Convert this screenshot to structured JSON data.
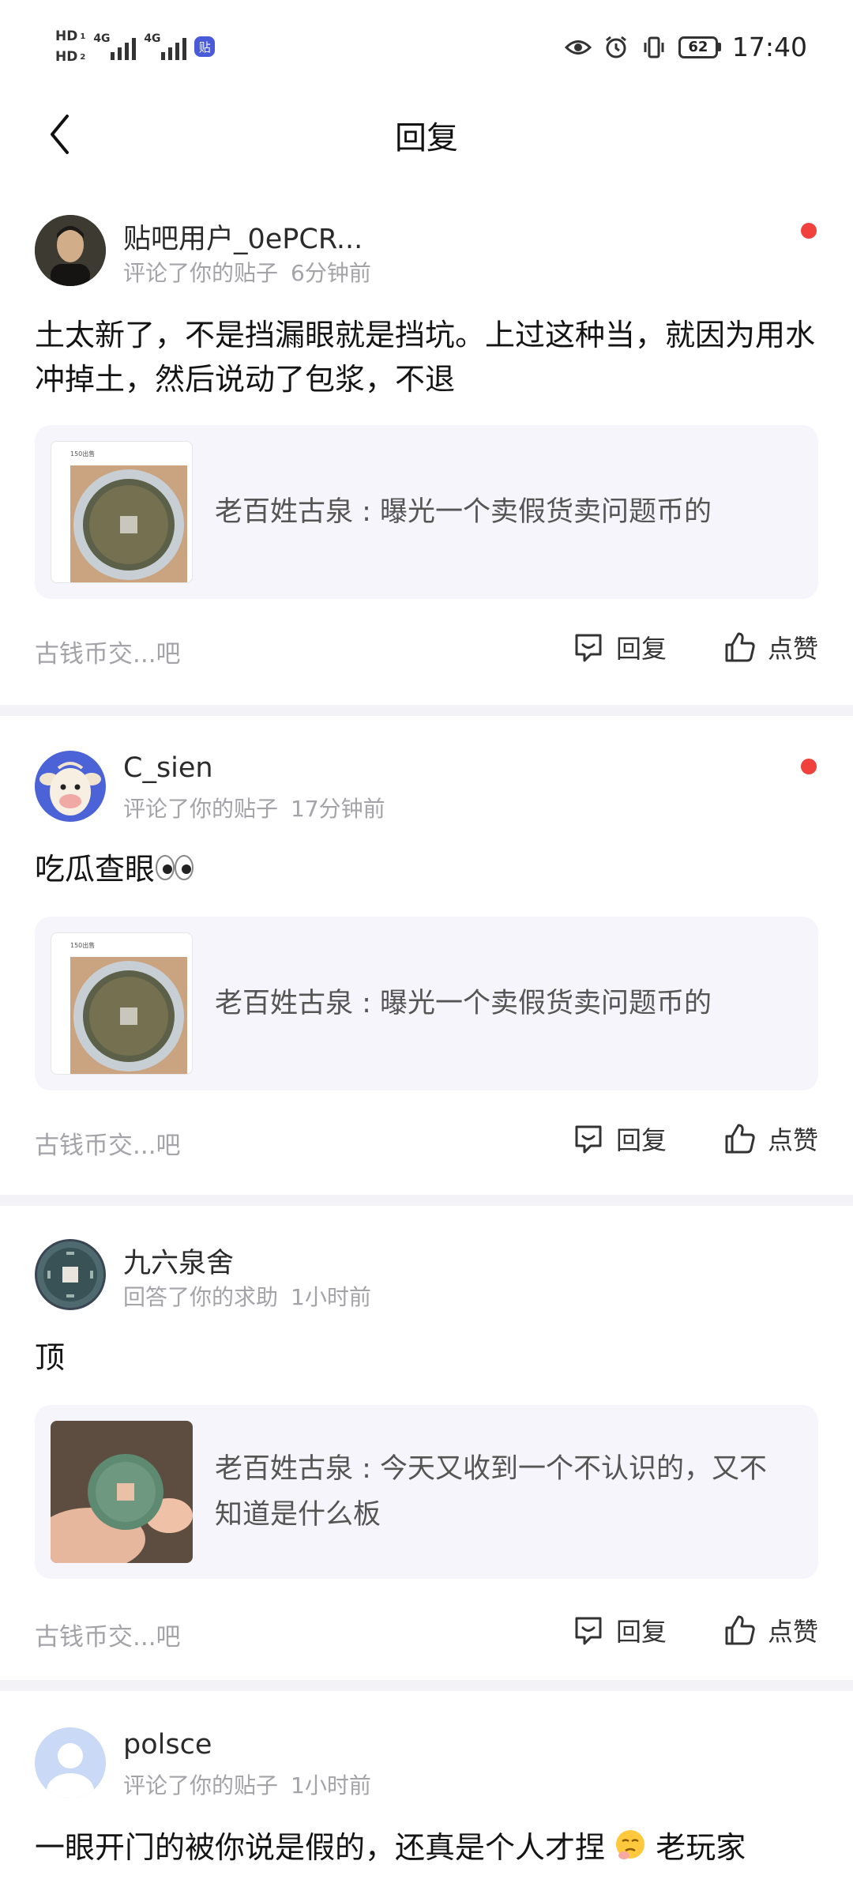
{
  "status_bar": {
    "hd1": "HD",
    "hd1_sub": "1",
    "hd2": "HD",
    "hd2_sub": "2",
    "net1": "4G",
    "net2": "4G",
    "app_badge": "贴",
    "battery": "62",
    "time": "17:40"
  },
  "nav": {
    "title": "回复",
    "back_icon": "back-arrow-icon"
  },
  "items": [
    {
      "username": "贴吧用户_0ePCR...",
      "action": "评论了你的贴子",
      "time": "6分钟前",
      "unread": true,
      "content": "土太新了，不是挡漏眼就是挡坑。上过这种当，就因为用水冲掉土，然后说动了包浆，不退",
      "quote": {
        "caption": "150出售",
        "text": "老百姓古泉 : 曝光一个卖假货卖问题币的"
      },
      "forum": "古钱币交...吧",
      "reply_label": "回复",
      "like_label": "点赞"
    },
    {
      "username": "C_sien",
      "action": "评论了你的贴子",
      "time": "17分钟前",
      "unread": true,
      "content": "吃瓜查眼",
      "quote": {
        "caption": "150出售",
        "text": "老百姓古泉 : 曝光一个卖假货卖问题币的"
      },
      "forum": "古钱币交...吧",
      "reply_label": "回复",
      "like_label": "点赞"
    },
    {
      "username": "九六泉舍",
      "action": "回答了你的求助",
      "time": "1小时前",
      "unread": false,
      "content": "顶",
      "quote": {
        "caption": "",
        "text": "老百姓古泉 : 今天又收到一个不认识的，又不知道是什么板"
      },
      "forum": "古钱币交...吧",
      "reply_label": "回复",
      "like_label": "点赞"
    },
    {
      "username": "polsce",
      "action": "评论了你的贴子",
      "time": "1小时前",
      "unread": false,
      "content_before": "一眼开门的被你说是假的，还真是个人才捏",
      "content_after": "老玩家"
    }
  ],
  "colors": {
    "accent": "#f0413c",
    "quote_bg": "#f5f5fb",
    "separator": "#f3f3f7",
    "muted_text": "#a3a3a8"
  }
}
